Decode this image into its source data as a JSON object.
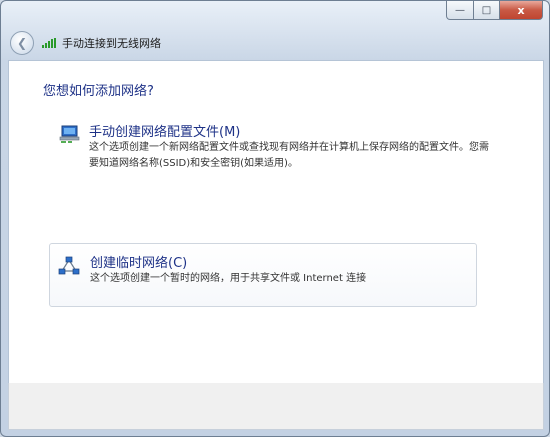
{
  "window": {
    "controls": {
      "minimize_icon": "minimize-icon",
      "maximize_icon": "maximize-icon",
      "close_label": "x"
    }
  },
  "navbar": {
    "back_icon": "back-arrow-icon",
    "network_icon": "wireless-signal-icon",
    "title": "手动连接到无线网络"
  },
  "main": {
    "question": "您想如何添加网络?",
    "options": [
      {
        "icon": "wireless-computer-icon",
        "title": "手动创建网络配置文件(M)",
        "description": "这个选项创建一个新网络配置文件或查找现有网络并在计算机上保存网络的配置文件。您需要知道网络名称(SSID)和安全密钥(如果适用)。"
      },
      {
        "icon": "adhoc-network-icon",
        "title": "创建临时网络(C)",
        "description": "这个选项创建一个暂时的网络，用于共享文件或 Internet 连接"
      }
    ]
  },
  "colors": {
    "link_blue": "#1e3287",
    "signal_green": "#2a9a2a",
    "close_red": "#c95a45"
  }
}
